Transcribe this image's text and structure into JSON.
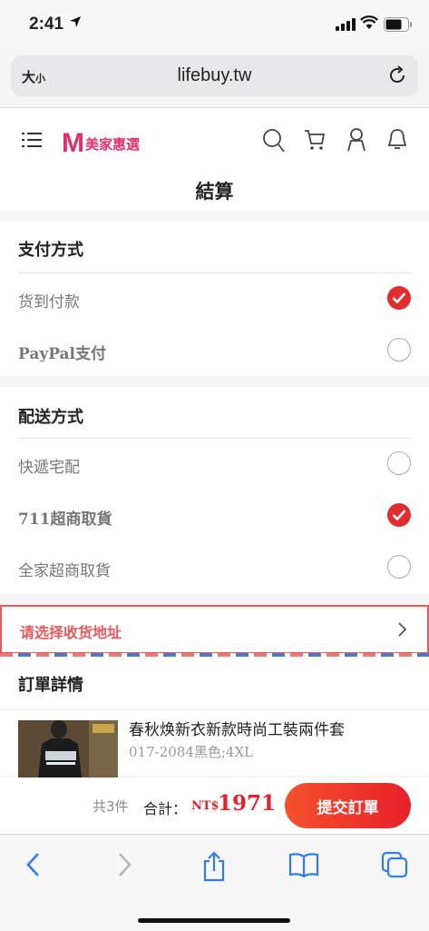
{
  "status_bar": {
    "time": "2:41"
  },
  "browser": {
    "text_size_label": "大",
    "text_size_small": "小",
    "url": "lifebuy.tw"
  },
  "site": {
    "logo_mark": "M",
    "brand_name": "美家惠選",
    "page_title": "結算"
  },
  "payment": {
    "title": "支付方式",
    "options": [
      {
        "label": "货到付款",
        "selected": true
      },
      {
        "label": "PayPal支付",
        "selected": false
      }
    ]
  },
  "shipping": {
    "title": "配送方式",
    "options": [
      {
        "label": "快遞宅配",
        "selected": false
      },
      {
        "label": "711超商取貨",
        "selected": true
      },
      {
        "label": "全家超商取貨",
        "selected": false
      }
    ]
  },
  "address": {
    "prompt": "请选择收货地址"
  },
  "order": {
    "title": "訂單詳情",
    "items": [
      {
        "name": "春秋焕新衣新款時尚工裝兩件套",
        "spec": "017-2084黑色;4XL"
      }
    ]
  },
  "checkout": {
    "count_text": "共3件",
    "total_label": "合計：",
    "currency": "NT$",
    "total": "1971",
    "submit_label": "提交訂單"
  },
  "colors": {
    "accent": "#e02d2d",
    "brand": "#e0306b",
    "link": "#2f7cf6"
  }
}
